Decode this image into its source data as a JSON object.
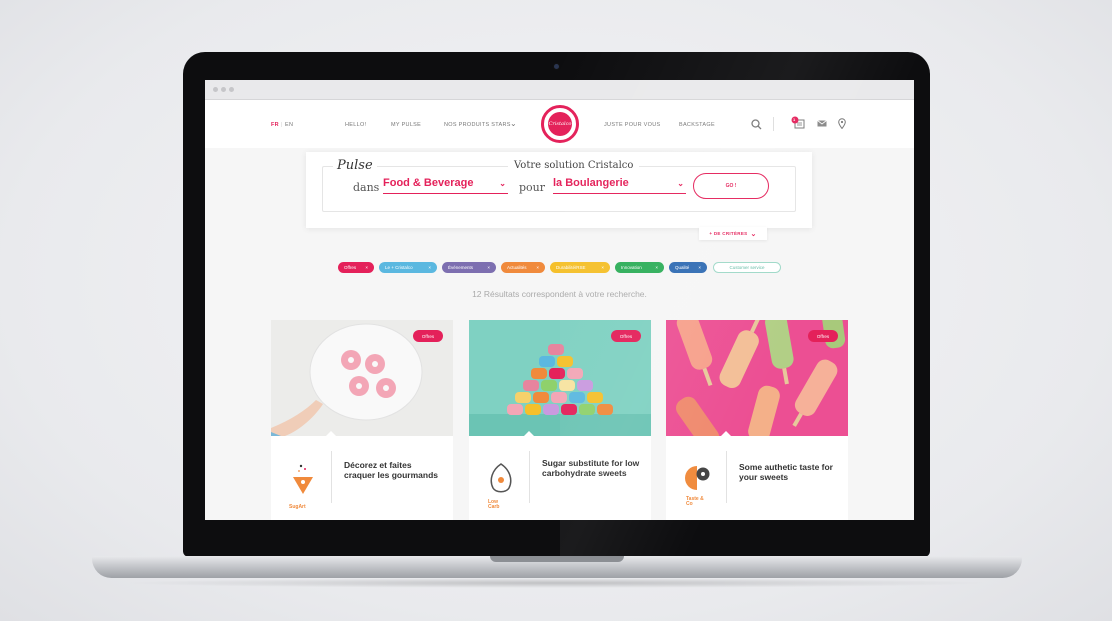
{
  "nav": {
    "lang_fr": "FR",
    "lang_en": "EN",
    "hello": "HELLO!",
    "my_pulse": "MY PULSE",
    "produits": "NOS PRODUITS STARS",
    "produits_chevron": "⌄",
    "juste": "JUSTE POUR VOUS",
    "backstage": "BACKSTAGE",
    "logo_text": "Cristalco",
    "notif_count": "1",
    "search_icon": "search-icon",
    "mail_icon": "mail-icon",
    "pin_icon": "map-pin-icon"
  },
  "search": {
    "pulse_label": "Pulse",
    "solution_title": "Votre solution Cristalco",
    "dans": "dans",
    "sector_value": "Food & Beverage",
    "pour": "pour",
    "target_value": "la Boulangerie",
    "go_label": "GO !",
    "more_criteria": "+ DE CRITÈRES",
    "more_chevron": "⌄"
  },
  "filters": [
    {
      "label": "Offres",
      "color": "#e4215a"
    },
    {
      "label": "Le + Cristalco",
      "color": "#5bb8e0"
    },
    {
      "label": "Événements",
      "color": "#7d6fb0"
    },
    {
      "label": "Actualités",
      "color": "#f08a3c"
    },
    {
      "label": "Durabilité/RSE",
      "color": "#f5c02b"
    },
    {
      "label": "Innovation",
      "color": "#2fae5a"
    },
    {
      "label": "Qualité",
      "color": "#2f6bb3"
    }
  ],
  "customer_service": "Customer service",
  "results_text": "12 Résultats correspondent à votre recherche.",
  "cards": [
    {
      "badge": "Offres",
      "title": "Décorez et faites craquer les gourmands",
      "brand": "SugArt"
    },
    {
      "badge": "Offres",
      "title": "Sugar substitute for low carbohydrate sweets",
      "brand": "Low Carb"
    },
    {
      "badge": "Offres",
      "title": "Some authetic taste for your sweets",
      "brand": "Taste & Co"
    }
  ]
}
